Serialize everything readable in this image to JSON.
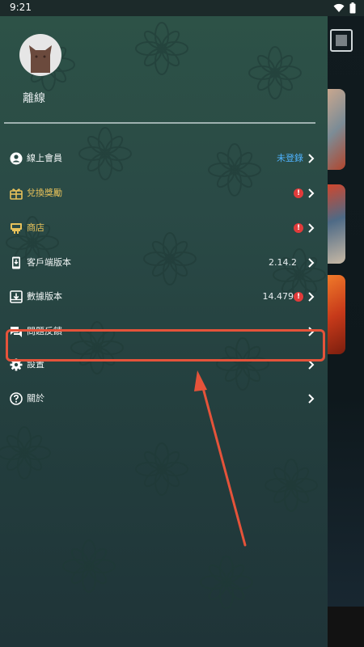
{
  "status_bar": {
    "time": "9:21"
  },
  "drawer": {
    "username": "離線",
    "menu": [
      {
        "id": "member",
        "label": "線上會員",
        "value": "未登錄",
        "icon": "account-circle-icon",
        "badge": ""
      },
      {
        "id": "redeem",
        "label": "兌換獎勵",
        "value": "",
        "icon": "gift-icon",
        "badge": "!"
      },
      {
        "id": "shop",
        "label": "商店",
        "value": "",
        "icon": "store-icon",
        "badge": "!"
      },
      {
        "id": "client",
        "label": "客戶端版本",
        "value": "2.14.2",
        "icon": "phone-download-icon",
        "badge": ""
      },
      {
        "id": "data",
        "label": "數據版本",
        "value": "14.479",
        "icon": "download-box-icon",
        "badge": "!"
      },
      {
        "id": "feedback",
        "label": "問題反饋",
        "value": "",
        "icon": "chat-icon",
        "badge": ""
      },
      {
        "id": "settings",
        "label": "設置",
        "value": "",
        "icon": "gear-icon",
        "badge": ""
      },
      {
        "id": "about",
        "label": "關於",
        "value": "",
        "icon": "help-circle-icon",
        "badge": ""
      }
    ]
  },
  "colors": {
    "accent_gold": "#e7c15a",
    "link_blue": "#4fb3ff",
    "alert_red": "#e23b3b",
    "annotation_red": "#e5533a"
  }
}
